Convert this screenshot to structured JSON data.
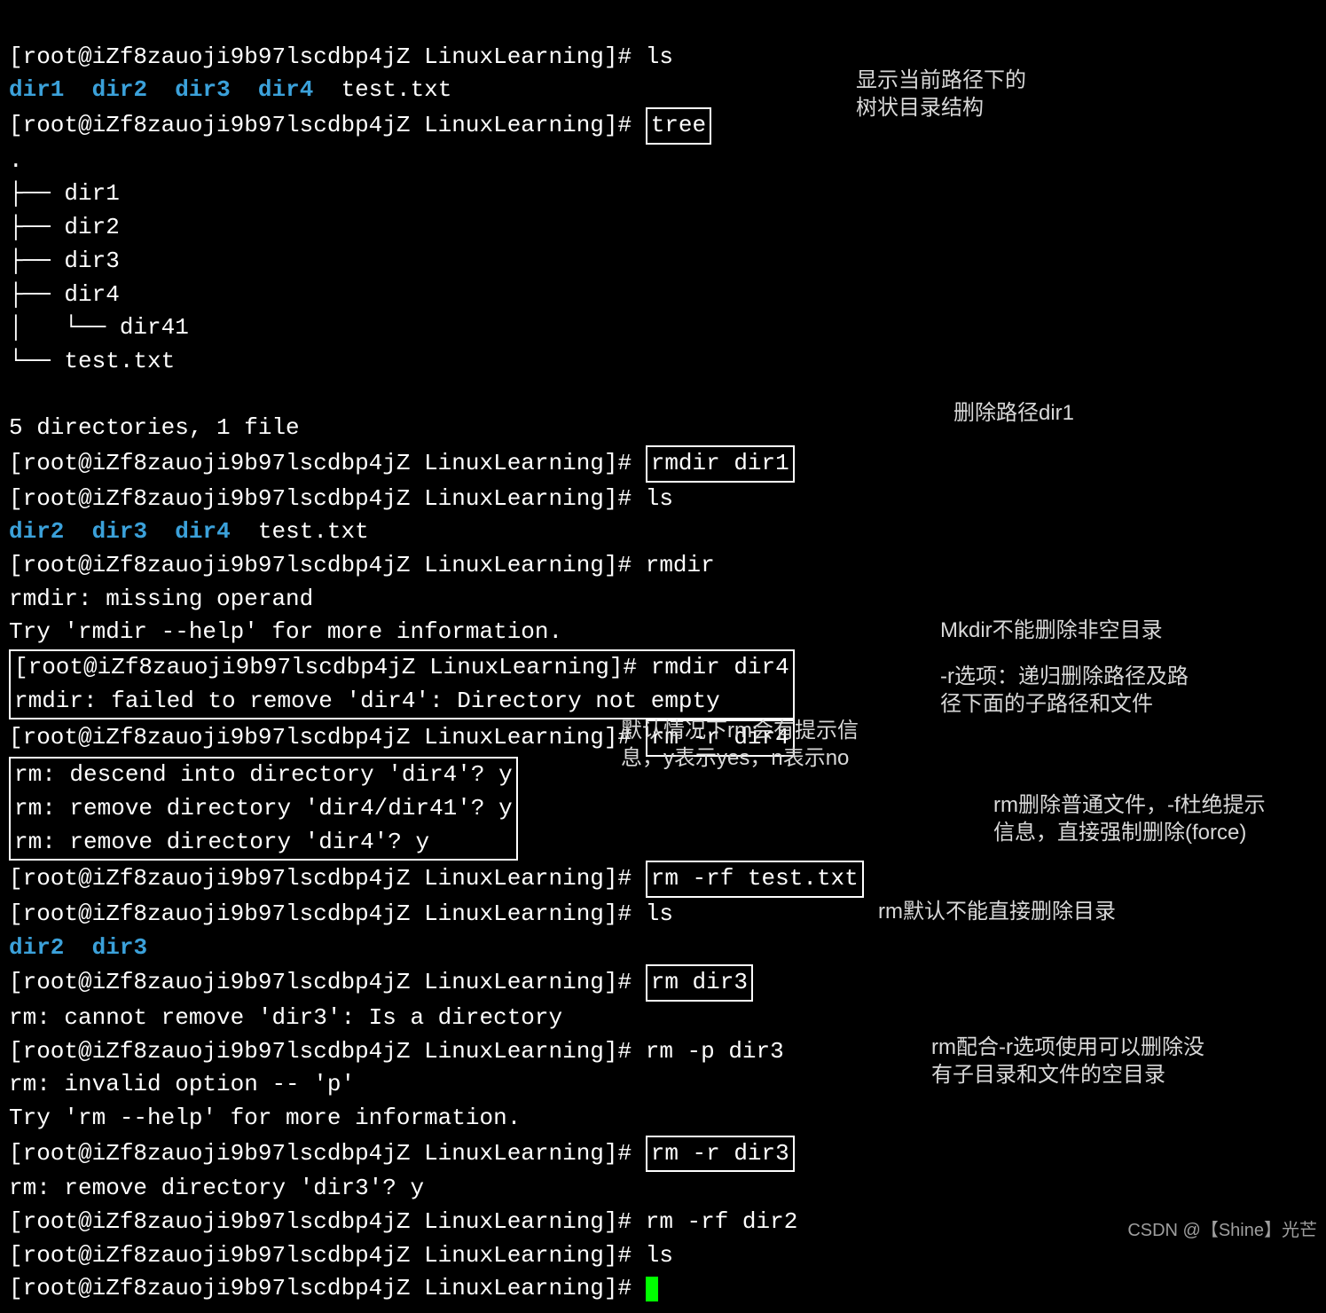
{
  "prompt": "[root@iZf8zauoji9b97lscdbp4jZ LinuxLearning]# ",
  "lines": {
    "ls1": "ls",
    "ls1_out": [
      "dir1",
      "dir2",
      "dir3",
      "dir4",
      "test.txt"
    ],
    "tree_cmd": "tree",
    "tree_out": [
      ".",
      "├── dir1",
      "├── dir2",
      "├── dir3",
      "├── dir4",
      "│   └── dir41",
      "└── test.txt"
    ],
    "tree_summary": "5 directories, 1 file",
    "rmdir1": "rmdir dir1",
    "ls2": "ls",
    "ls2_out": [
      "dir2",
      "dir3",
      "dir4",
      "test.txt"
    ],
    "rmdir_bare": "rmdir",
    "rmdir_err1": "rmdir: missing operand",
    "rmdir_err2": "Try 'rmdir --help' for more information.",
    "rmdir_dir4": "rmdir dir4",
    "rmdir_dir4_err": "rmdir: failed to remove 'dir4': Directory not empty",
    "rm_r_dir4": "rm -r dir4",
    "rm_r_dir4_p1": "rm: descend into directory 'dir4'? y",
    "rm_r_dir4_p2": "rm: remove directory 'dir4/dir41'? y",
    "rm_r_dir4_p3": "rm: remove directory 'dir4'? y",
    "rm_rf_test": "rm -rf test.txt",
    "ls3": "ls",
    "ls3_out": [
      "dir2",
      "dir3"
    ],
    "rm_dir3": "rm dir3",
    "rm_dir3_err": "rm: cannot remove 'dir3': Is a directory",
    "rm_p_dir3": "rm -p dir3",
    "rm_p_err1": "rm: invalid option -- 'p'",
    "rm_p_err2": "Try 'rm --help' for more information.",
    "rm_r_dir3": "rm -r dir3",
    "rm_r_dir3_p": "rm: remove directory 'dir3'? y",
    "rm_rf_dir2": "rm -rf dir2",
    "ls4": "ls"
  },
  "annotations": {
    "a1": "显示当前路径下的\n树状目录结构",
    "a2": "删除路径dir1",
    "a3": "Mkdir不能删除非空目录",
    "a4": "-r选项：递归删除路径及路\n径下面的子路径和文件",
    "a5": "默认情况下rm会有提示信\n息，y表示yes，n表示no",
    "a6": "rm删除普通文件，-f杜绝提示\n信息，直接强制删除(force)",
    "a7": "rm默认不能直接删除目录",
    "a8": "rm配合-r选项使用可以删除没\n有子目录和文件的空目录"
  },
  "watermark": "CSDN @【Shine】光芒"
}
